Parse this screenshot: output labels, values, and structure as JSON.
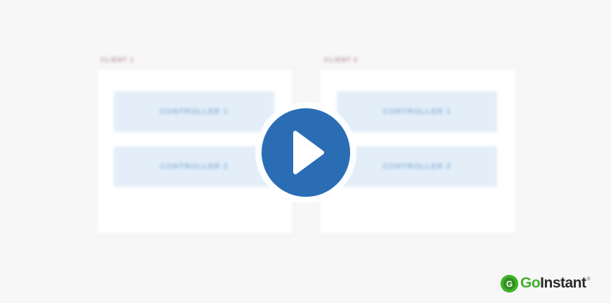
{
  "clients": [
    {
      "label": "CLIENT 1",
      "controllers": [
        "CONTROLLER 1",
        "CONTROLLER 2"
      ]
    },
    {
      "label": "CLIENT 2",
      "controllers": [
        "CONTROLLER 1",
        "CONTROLLER 2"
      ]
    }
  ],
  "player": {
    "play_icon": "play-icon"
  },
  "logo": {
    "prefix": "Go",
    "suffix": "Instant",
    "registered": "®",
    "mark_letter": "G"
  },
  "colors": {
    "background": "#f7f7f7",
    "play_button": "#2a6db5",
    "controller_fill": "#e3eef9",
    "brand_green": "#3fb12a"
  }
}
